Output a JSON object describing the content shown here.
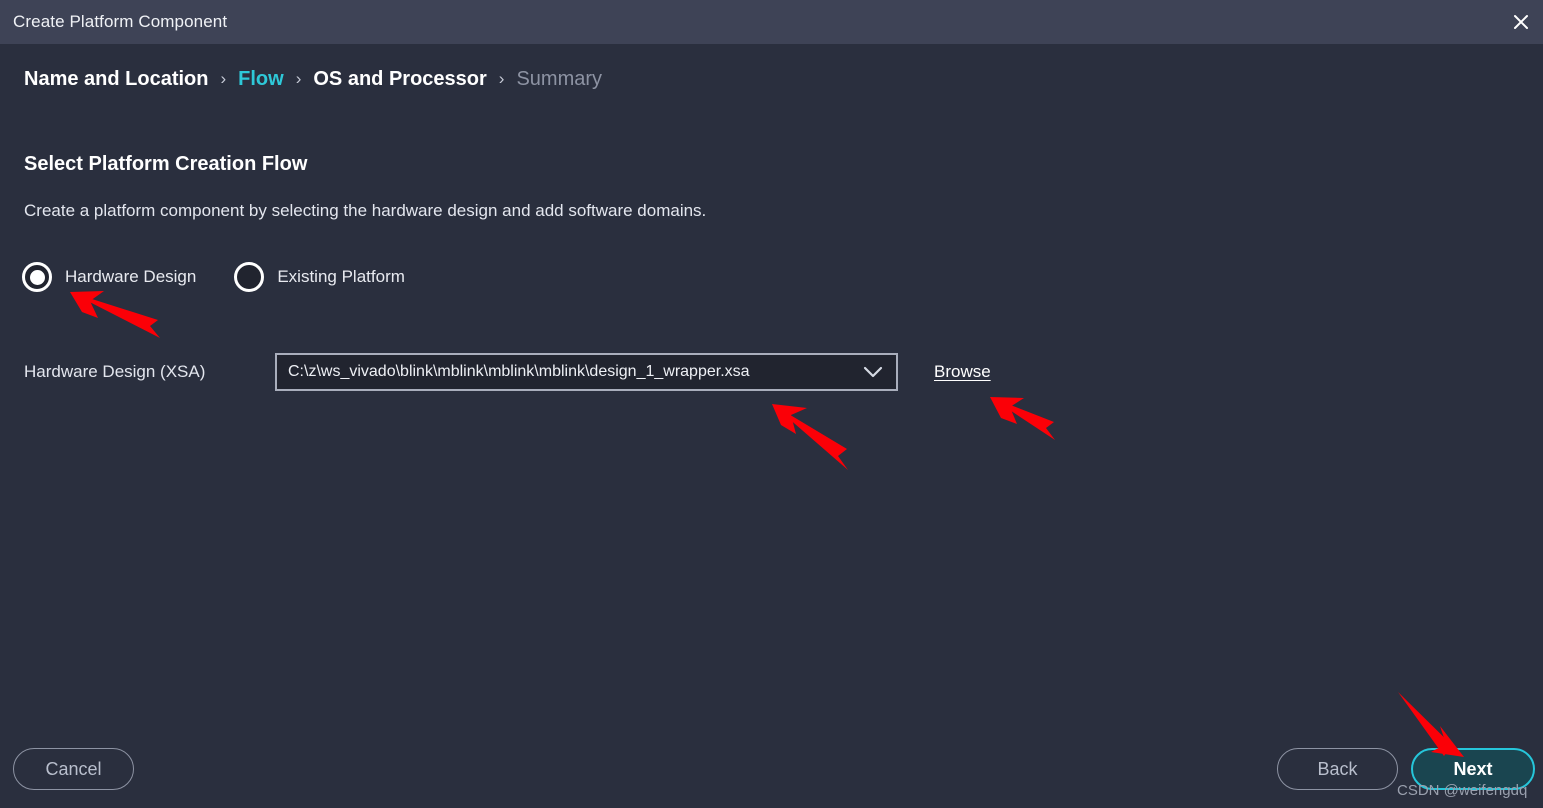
{
  "window": {
    "title": "Create Platform Component",
    "close_icon": "close-icon"
  },
  "breadcrumb": {
    "separator": "›",
    "steps": [
      {
        "label": "Name and Location",
        "state": "completed"
      },
      {
        "label": "Flow",
        "state": "current"
      },
      {
        "label": "OS and Processor",
        "state": "completed"
      },
      {
        "label": "Summary",
        "state": "upcoming"
      }
    ]
  },
  "content": {
    "heading": "Select Platform Creation Flow",
    "description": "Create a platform component by selecting the hardware design and add software domains.",
    "flow_options": [
      {
        "label": "Hardware Design",
        "selected": true
      },
      {
        "label": "Existing Platform",
        "selected": false
      }
    ],
    "hardware_field": {
      "label": "Hardware Design (XSA)",
      "value": "C:\\z\\ws_vivado\\blink\\mblink\\mblink\\mblink\\design_1_wrapper.xsa",
      "dropdown_icon": "chevron-down-icon",
      "browse_label": "Browse"
    }
  },
  "footer": {
    "cancel_label": "Cancel",
    "back_label": "Back",
    "next_label": "Next"
  },
  "watermark": {
    "text": "CSDN @weifengdq"
  },
  "colors": {
    "titlebar_bg": "#3e4356",
    "body_bg": "#2a2f3e",
    "accent_cyan": "#2ec8d8",
    "next_border": "#26c6da",
    "next_fill": "#1a4550",
    "dim_text": "#8d93a3",
    "annotation_red": "#fb0007"
  }
}
